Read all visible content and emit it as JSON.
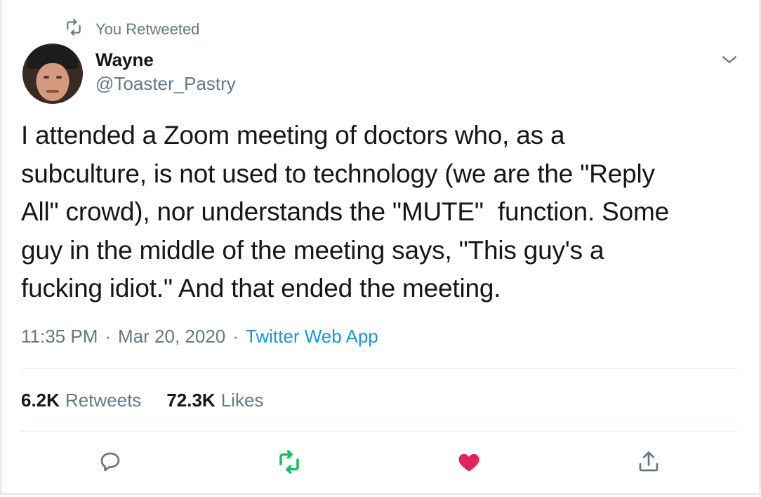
{
  "retweet_context": {
    "label": "You Retweeted",
    "icon": "retweet-icon"
  },
  "author": {
    "name": "Wayne",
    "handle": "@Toaster_Pastry",
    "avatar_icon": "avatar"
  },
  "menu": {
    "icon": "chevron-down-icon"
  },
  "tweet": {
    "text": "I attended a Zoom meeting of doctors who, as a\nsubculture, is not used to technology (we are the \"Reply\nAll\" crowd), nor understands the \"MUTE\"  function. Some\nguy in the middle of the meeting says, \"This guy's a\nfucking idiot.\" And that ended the meeting."
  },
  "meta": {
    "time": "11:35 PM",
    "separator": "·",
    "date": "Mar 20, 2020",
    "app": "Twitter Web App"
  },
  "stats": {
    "retweets_count": "6.2K",
    "retweets_label": "Retweets",
    "likes_count": "72.3K",
    "likes_label": "Likes"
  },
  "actions": [
    {
      "name": "reply",
      "icon": "reply-icon"
    },
    {
      "name": "retweet",
      "icon": "retweet-icon",
      "active": true,
      "color": "#17bf63"
    },
    {
      "name": "like",
      "icon": "heart-icon",
      "active": true,
      "color": "#e0245e"
    },
    {
      "name": "share",
      "icon": "share-icon"
    }
  ],
  "colors": {
    "text": "#14171a",
    "secondary": "#657786",
    "link": "#1b95e0",
    "retweet_green": "#17bf63",
    "like_red": "#e0245e"
  }
}
